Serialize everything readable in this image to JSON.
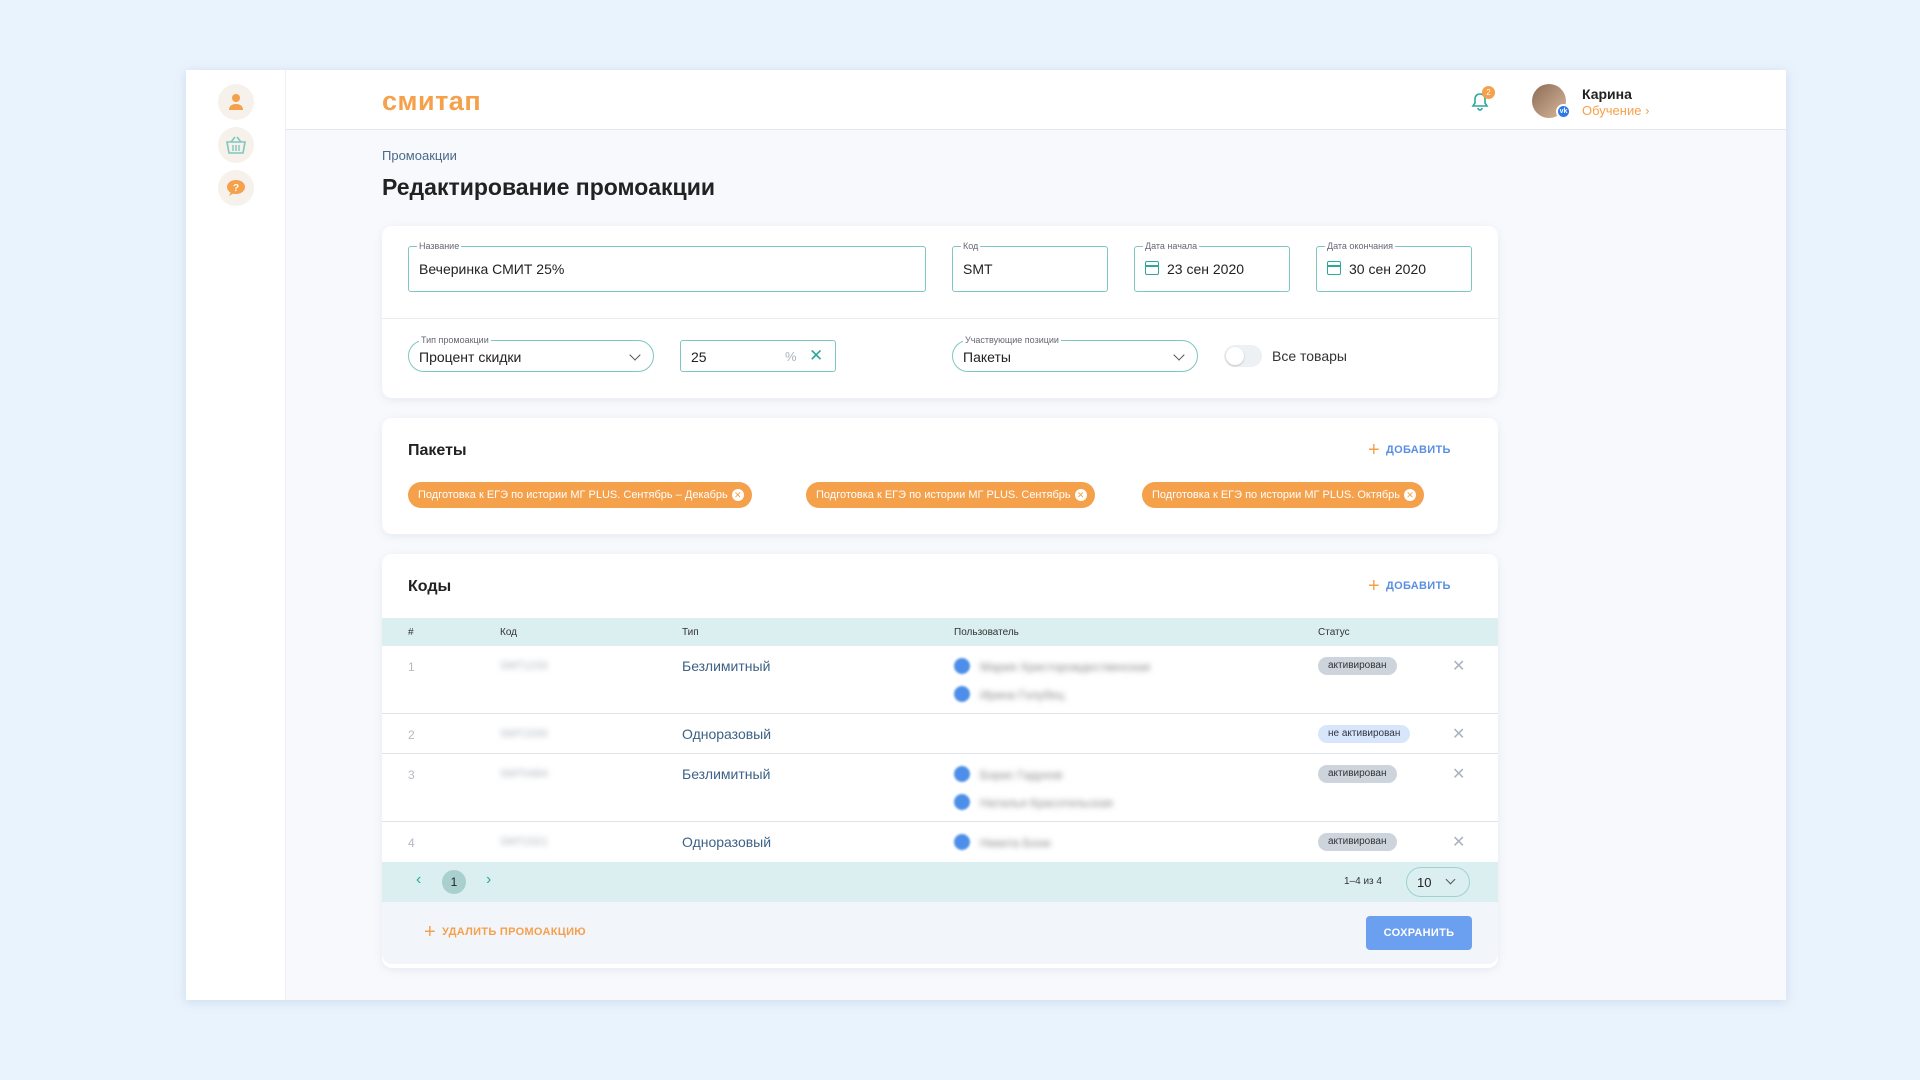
{
  "brand": {
    "logo": "смитап",
    "accent": "#f5a04b",
    "teal": "#2ea89b",
    "blue": "#5a8fe0"
  },
  "sidebar": {
    "items": [
      {
        "icon": "user-icon"
      },
      {
        "icon": "basket-icon"
      },
      {
        "icon": "help-icon"
      }
    ]
  },
  "header": {
    "notifications_count": "2",
    "user_name": "Карина",
    "user_role": "Обучение"
  },
  "breadcrumb": "Промоакции",
  "page_title": "Редактирование промоакции",
  "form": {
    "name": {
      "label": "Название",
      "value": "Вечеринка СМИТ 25%"
    },
    "code": {
      "label": "Код",
      "value": "SMT"
    },
    "start_date": {
      "label": "Дата начала",
      "value": "23 сен 2020"
    },
    "end_date": {
      "label": "Дата окончания",
      "value": "30 сен 2020"
    },
    "promo_type": {
      "label": "Тип промоакции",
      "value": "Процент скидки"
    },
    "discount": {
      "value": "25",
      "unit": "%"
    },
    "positions": {
      "label": "Участвующие позиции",
      "value": "Пакеты"
    },
    "all_goods": {
      "label": "Все товары",
      "checked": false
    }
  },
  "packages": {
    "title": "Пакеты",
    "add_label": "ДОБАВИТЬ",
    "chips": [
      "Подготовка к ЕГЭ по истории МГ PLUS. Сентябрь – Декабрь",
      "Подготовка к ЕГЭ по истории МГ PLUS. Сентябрь",
      "Подготовка к ЕГЭ по истории МГ PLUS. Октябрь"
    ]
  },
  "codes": {
    "title": "Коды",
    "add_label": "ДОБАВИТЬ",
    "columns": [
      "#",
      "Код",
      "Тип",
      "Пользователь",
      "Статус"
    ],
    "rows": [
      {
        "n": "1",
        "code": "SMT1233",
        "type": "Безлимитный",
        "users": [
          "Мария Христорождественская",
          "Ирина Голубец"
        ],
        "status": "активирован"
      },
      {
        "n": "2",
        "code": "SMT2330",
        "type": "Одноразовый",
        "users": [],
        "status": "не активирован"
      },
      {
        "n": "3",
        "code": "SMT0484",
        "type": "Безлимитный",
        "users": [
          "Борис Гадунов",
          "Наталья Красотельская"
        ],
        "status": "активирован"
      },
      {
        "n": "4",
        "code": "SMT2321",
        "type": "Одноразовый",
        "users": [
          "Никита Бони"
        ],
        "status": "активирован"
      }
    ],
    "pagination": {
      "current_page": "1",
      "range": "1–4 из 4",
      "per_page": "10"
    }
  },
  "footer": {
    "delete_label": "УДАЛИТЬ ПРОМОАКЦИЮ",
    "save_label": "СОХРАНИТЬ"
  }
}
